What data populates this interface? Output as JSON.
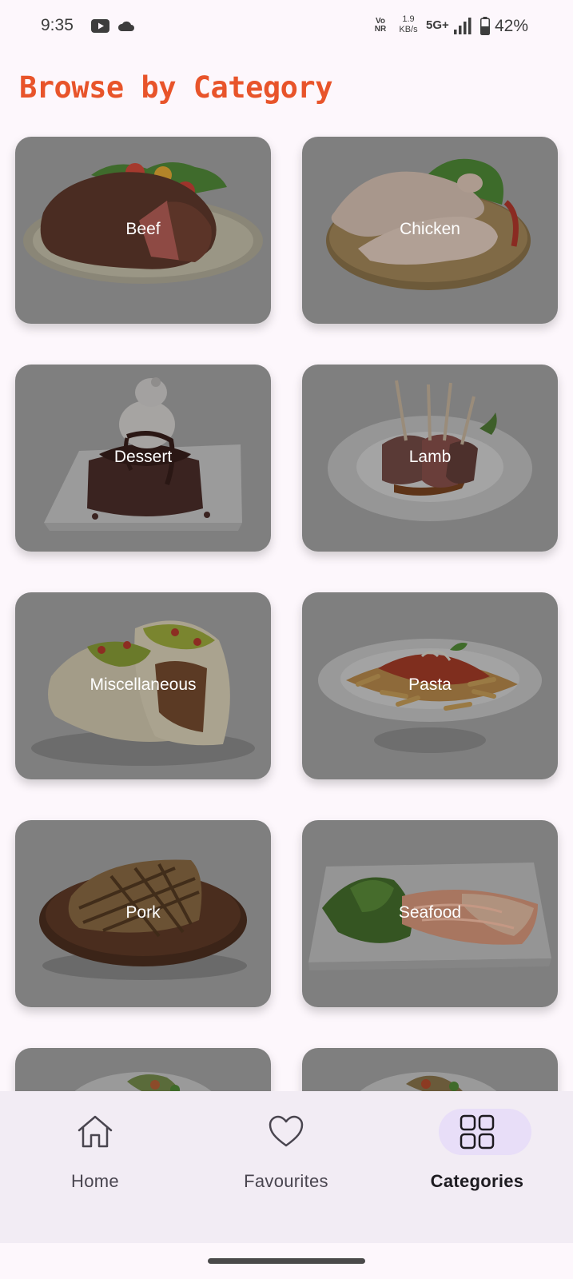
{
  "status_bar": {
    "time": "9:35",
    "volte_line1": "Vo",
    "volte_line2": "NR",
    "speed_value": "1.9",
    "speed_unit": "KB/s",
    "network": "5G+",
    "battery": "42%",
    "icons": [
      "youtube-icon",
      "cloud-icon",
      "signal-icon",
      "battery-icon"
    ]
  },
  "title": "Browse by Category",
  "colors": {
    "accent": "#e8542a",
    "card_overlay": "#7f7f7f",
    "nav_background": "#f2ecf4",
    "nav_active_pill": "#e8def8"
  },
  "categories": [
    {
      "label": "Beef"
    },
    {
      "label": "Chicken"
    },
    {
      "label": "Dessert"
    },
    {
      "label": "Lamb"
    },
    {
      "label": "Miscellaneous"
    },
    {
      "label": "Pasta"
    },
    {
      "label": "Pork"
    },
    {
      "label": "Seafood"
    },
    {
      "label": ""
    },
    {
      "label": ""
    }
  ],
  "nav": {
    "items": [
      {
        "label": "Home",
        "icon": "home-icon",
        "active": false
      },
      {
        "label": "Favourites",
        "icon": "heart-icon",
        "active": false
      },
      {
        "label": "Categories",
        "icon": "grid-icon",
        "active": true
      }
    ]
  }
}
